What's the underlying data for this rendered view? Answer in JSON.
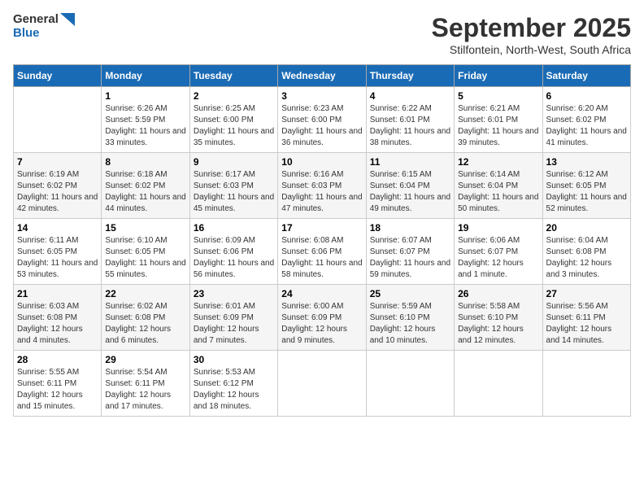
{
  "header": {
    "logo_line1": "General",
    "logo_line2": "Blue",
    "month": "September 2025",
    "location": "Stilfontein, North-West, South Africa"
  },
  "days_of_week": [
    "Sunday",
    "Monday",
    "Tuesday",
    "Wednesday",
    "Thursday",
    "Friday",
    "Saturday"
  ],
  "weeks": [
    [
      {
        "day": null,
        "sunrise": null,
        "sunset": null,
        "daylight": null
      },
      {
        "day": "1",
        "sunrise": "Sunrise: 6:26 AM",
        "sunset": "Sunset: 5:59 PM",
        "daylight": "Daylight: 11 hours and 33 minutes."
      },
      {
        "day": "2",
        "sunrise": "Sunrise: 6:25 AM",
        "sunset": "Sunset: 6:00 PM",
        "daylight": "Daylight: 11 hours and 35 minutes."
      },
      {
        "day": "3",
        "sunrise": "Sunrise: 6:23 AM",
        "sunset": "Sunset: 6:00 PM",
        "daylight": "Daylight: 11 hours and 36 minutes."
      },
      {
        "day": "4",
        "sunrise": "Sunrise: 6:22 AM",
        "sunset": "Sunset: 6:01 PM",
        "daylight": "Daylight: 11 hours and 38 minutes."
      },
      {
        "day": "5",
        "sunrise": "Sunrise: 6:21 AM",
        "sunset": "Sunset: 6:01 PM",
        "daylight": "Daylight: 11 hours and 39 minutes."
      },
      {
        "day": "6",
        "sunrise": "Sunrise: 6:20 AM",
        "sunset": "Sunset: 6:02 PM",
        "daylight": "Daylight: 11 hours and 41 minutes."
      }
    ],
    [
      {
        "day": "7",
        "sunrise": "Sunrise: 6:19 AM",
        "sunset": "Sunset: 6:02 PM",
        "daylight": "Daylight: 11 hours and 42 minutes."
      },
      {
        "day": "8",
        "sunrise": "Sunrise: 6:18 AM",
        "sunset": "Sunset: 6:02 PM",
        "daylight": "Daylight: 11 hours and 44 minutes."
      },
      {
        "day": "9",
        "sunrise": "Sunrise: 6:17 AM",
        "sunset": "Sunset: 6:03 PM",
        "daylight": "Daylight: 11 hours and 45 minutes."
      },
      {
        "day": "10",
        "sunrise": "Sunrise: 6:16 AM",
        "sunset": "Sunset: 6:03 PM",
        "daylight": "Daylight: 11 hours and 47 minutes."
      },
      {
        "day": "11",
        "sunrise": "Sunrise: 6:15 AM",
        "sunset": "Sunset: 6:04 PM",
        "daylight": "Daylight: 11 hours and 49 minutes."
      },
      {
        "day": "12",
        "sunrise": "Sunrise: 6:14 AM",
        "sunset": "Sunset: 6:04 PM",
        "daylight": "Daylight: 11 hours and 50 minutes."
      },
      {
        "day": "13",
        "sunrise": "Sunrise: 6:12 AM",
        "sunset": "Sunset: 6:05 PM",
        "daylight": "Daylight: 11 hours and 52 minutes."
      }
    ],
    [
      {
        "day": "14",
        "sunrise": "Sunrise: 6:11 AM",
        "sunset": "Sunset: 6:05 PM",
        "daylight": "Daylight: 11 hours and 53 minutes."
      },
      {
        "day": "15",
        "sunrise": "Sunrise: 6:10 AM",
        "sunset": "Sunset: 6:05 PM",
        "daylight": "Daylight: 11 hours and 55 minutes."
      },
      {
        "day": "16",
        "sunrise": "Sunrise: 6:09 AM",
        "sunset": "Sunset: 6:06 PM",
        "daylight": "Daylight: 11 hours and 56 minutes."
      },
      {
        "day": "17",
        "sunrise": "Sunrise: 6:08 AM",
        "sunset": "Sunset: 6:06 PM",
        "daylight": "Daylight: 11 hours and 58 minutes."
      },
      {
        "day": "18",
        "sunrise": "Sunrise: 6:07 AM",
        "sunset": "Sunset: 6:07 PM",
        "daylight": "Daylight: 11 hours and 59 minutes."
      },
      {
        "day": "19",
        "sunrise": "Sunrise: 6:06 AM",
        "sunset": "Sunset: 6:07 PM",
        "daylight": "Daylight: 12 hours and 1 minute."
      },
      {
        "day": "20",
        "sunrise": "Sunrise: 6:04 AM",
        "sunset": "Sunset: 6:08 PM",
        "daylight": "Daylight: 12 hours and 3 minutes."
      }
    ],
    [
      {
        "day": "21",
        "sunrise": "Sunrise: 6:03 AM",
        "sunset": "Sunset: 6:08 PM",
        "daylight": "Daylight: 12 hours and 4 minutes."
      },
      {
        "day": "22",
        "sunrise": "Sunrise: 6:02 AM",
        "sunset": "Sunset: 6:08 PM",
        "daylight": "Daylight: 12 hours and 6 minutes."
      },
      {
        "day": "23",
        "sunrise": "Sunrise: 6:01 AM",
        "sunset": "Sunset: 6:09 PM",
        "daylight": "Daylight: 12 hours and 7 minutes."
      },
      {
        "day": "24",
        "sunrise": "Sunrise: 6:00 AM",
        "sunset": "Sunset: 6:09 PM",
        "daylight": "Daylight: 12 hours and 9 minutes."
      },
      {
        "day": "25",
        "sunrise": "Sunrise: 5:59 AM",
        "sunset": "Sunset: 6:10 PM",
        "daylight": "Daylight: 12 hours and 10 minutes."
      },
      {
        "day": "26",
        "sunrise": "Sunrise: 5:58 AM",
        "sunset": "Sunset: 6:10 PM",
        "daylight": "Daylight: 12 hours and 12 minutes."
      },
      {
        "day": "27",
        "sunrise": "Sunrise: 5:56 AM",
        "sunset": "Sunset: 6:11 PM",
        "daylight": "Daylight: 12 hours and 14 minutes."
      }
    ],
    [
      {
        "day": "28",
        "sunrise": "Sunrise: 5:55 AM",
        "sunset": "Sunset: 6:11 PM",
        "daylight": "Daylight: 12 hours and 15 minutes."
      },
      {
        "day": "29",
        "sunrise": "Sunrise: 5:54 AM",
        "sunset": "Sunset: 6:11 PM",
        "daylight": "Daylight: 12 hours and 17 minutes."
      },
      {
        "day": "30",
        "sunrise": "Sunrise: 5:53 AM",
        "sunset": "Sunset: 6:12 PM",
        "daylight": "Daylight: 12 hours and 18 minutes."
      },
      {
        "day": null,
        "sunrise": null,
        "sunset": null,
        "daylight": null
      },
      {
        "day": null,
        "sunrise": null,
        "sunset": null,
        "daylight": null
      },
      {
        "day": null,
        "sunrise": null,
        "sunset": null,
        "daylight": null
      },
      {
        "day": null,
        "sunrise": null,
        "sunset": null,
        "daylight": null
      }
    ]
  ]
}
